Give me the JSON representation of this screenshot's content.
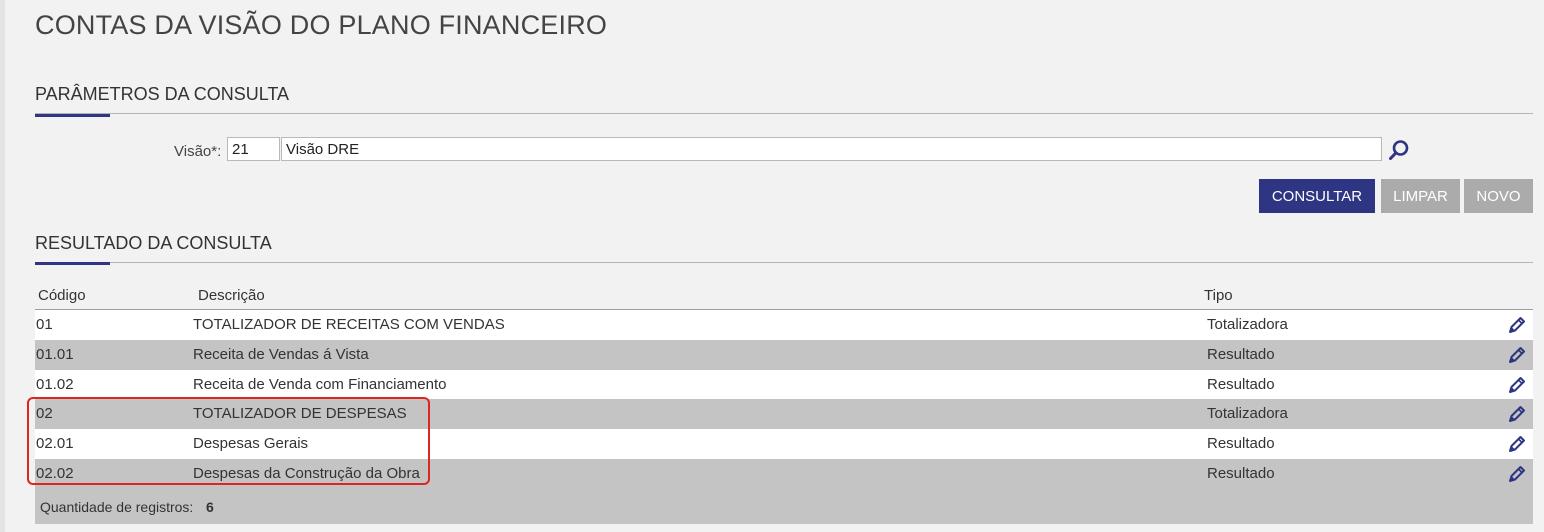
{
  "page": {
    "title": "CONTAS DA VISÃO DO PLANO FINANCEIRO"
  },
  "params": {
    "section_title": "PARÂMETROS DA CONSULTA",
    "visao_label": "Visão*:",
    "visao_code": "21",
    "visao_desc": "Visão DRE"
  },
  "buttons": {
    "consultar": "CONSULTAR",
    "limpar": "LIMPAR",
    "novo": "NOVO"
  },
  "results": {
    "section_title": "RESULTADO DA CONSULTA",
    "columns": {
      "codigo": "Código",
      "descricao": "Descrição",
      "tipo": "Tipo"
    },
    "rows": [
      {
        "codigo": "01",
        "descricao": "TOTALIZADOR DE RECEITAS COM VENDAS",
        "tipo": "Totalizadora"
      },
      {
        "codigo": "01.01",
        "descricao": "Receita de Vendas á Vista",
        "tipo": "Resultado"
      },
      {
        "codigo": "01.02",
        "descricao": "Receita de Venda com Financiamento",
        "tipo": "Resultado"
      },
      {
        "codigo": "02",
        "descricao": "TOTALIZADOR DE DESPESAS",
        "tipo": "Totalizadora"
      },
      {
        "codigo": "02.01",
        "descricao": "Despesas Gerais",
        "tipo": "Resultado"
      },
      {
        "codigo": "02.02",
        "descricao": "Despesas da Construção da Obra",
        "tipo": "Resultado"
      }
    ],
    "footer_label": "Quantidade de registros:",
    "footer_count": "6"
  },
  "icons": {
    "search": "magnifier-icon",
    "edit": "pencil-icon"
  },
  "colors": {
    "primary": "#2e3582",
    "disabled": "#ababab",
    "row_alt": "#c4c4c4",
    "highlight": "#e02424"
  }
}
